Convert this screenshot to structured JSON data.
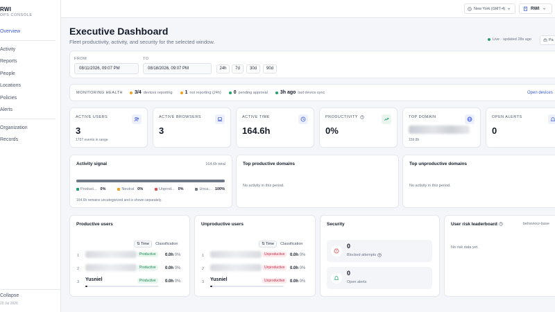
{
  "sidebar": {
    "brand": "RWI",
    "brand_sub": "OPS CONSOLE",
    "items": [
      {
        "label": "Overview"
      },
      {
        "label": "Activity"
      },
      {
        "label": "Reports"
      },
      {
        "label": "People"
      },
      {
        "label": "Locations"
      },
      {
        "label": "Policies"
      },
      {
        "label": "Alerts"
      },
      {
        "label": "Organization"
      },
      {
        "label": "Records"
      }
    ],
    "collapse_label": "Collapse",
    "footer_date": "20 Jul 2026"
  },
  "topbar": {
    "timezone": "New York (GMT-4)",
    "user": "RWI"
  },
  "header": {
    "title": "Executive Dashboard",
    "subtitle": "Fleet productivity, activity, and security for the selected window.",
    "live_status": "Live · updated 28s ago",
    "pa_button": "Pa"
  },
  "range": {
    "from_label": "FROM",
    "from_value": "08/11/2026, 09:07 PM",
    "to_label": "TO",
    "to_value": "08/18/2026, 09:07 PM",
    "quick": [
      "24h",
      "7d",
      "30d",
      "90d"
    ]
  },
  "health": {
    "title": "MONITORING HEALTH",
    "items": [
      {
        "value": "3/4",
        "label": "devices reporting",
        "color": "#f0a21b"
      },
      {
        "value": "1",
        "label": "not reporting (24h)",
        "color": "#f0a21b"
      },
      {
        "value": "0",
        "label": "pending approval",
        "color": "#22a06b"
      },
      {
        "value": "3h ago",
        "label": "last device sync",
        "color": "#22a06b"
      }
    ],
    "open_devices": "Open devices"
  },
  "stats": [
    {
      "label": "ACTIVE USERS",
      "value": "3",
      "hint": "1737 events in range",
      "icon": "users-icon"
    },
    {
      "label": "ACTIVE BROWSERS",
      "value": "3",
      "hint": "",
      "icon": "laptop-icon"
    },
    {
      "label": "ACTIVE TIME",
      "value": "164.6h",
      "hint": "",
      "icon": "clock-icon"
    },
    {
      "label": "PRODUCTIVITY",
      "value": "0%",
      "hint": "",
      "icon": "trend-up-icon"
    },
    {
      "label": "TOP DOMAIN",
      "value": "",
      "hint": "159.8h",
      "icon": "globe-icon"
    },
    {
      "label": "OPEN ALERTS",
      "value": "0",
      "hint": "",
      "icon": "bell-icon"
    }
  ],
  "activity_signal": {
    "title": "Activity signal",
    "total": "164.6h total",
    "legend": [
      {
        "label": "Product...",
        "value": "0%",
        "color": "#22a06b"
      },
      {
        "label": "Neutral",
        "value": "0%",
        "color": "#f0a21b"
      },
      {
        "label": "Unprod...",
        "value": "0%",
        "color": "#e5484d"
      },
      {
        "label": "Unca...",
        "value": "100%",
        "color": "#6e7788"
      }
    ],
    "note": "164.6h remains uncategorized and is shown separately."
  },
  "top_productive": {
    "title": "Top productive domains",
    "empty": "No activity in this period."
  },
  "top_unproductive": {
    "title": "Top unproductive domains",
    "empty": "No activity in this period."
  },
  "productive_users": {
    "title": "Productive users",
    "sort_label": "Time",
    "class_label": "Classification",
    "rows": [
      {
        "rank": "1",
        "name": "",
        "badge": "Productive",
        "time": "0.0h",
        "pct": "0%"
      },
      {
        "rank": "2",
        "name": "",
        "badge": "Productive",
        "time": "0.0h",
        "pct": "0%"
      },
      {
        "rank": "3",
        "name": "Yusniel",
        "badge": "Productive",
        "time": "0.0h",
        "pct": "0%"
      }
    ]
  },
  "unproductive_users": {
    "title": "Unproductive users",
    "sort_label": "Time",
    "class_label": "Classification",
    "rows": [
      {
        "rank": "1",
        "name": "",
        "badge": "Unproductive",
        "time": "0.0h",
        "pct": "0%"
      },
      {
        "rank": "2",
        "name": "",
        "badge": "Unproductive",
        "time": "0.0h",
        "pct": "0%"
      },
      {
        "rank": "3",
        "name": "Yusniel",
        "badge": "Unproductive",
        "time": "0.0h",
        "pct": "0%"
      }
    ]
  },
  "security": {
    "title": "Security",
    "blocked_value": "0",
    "blocked_label": "Blocked attempts",
    "alerts_value": "0",
    "alerts_label": "Open alerts"
  },
  "risk": {
    "title": "User risk leaderboard",
    "subtitle": "behaviour-base",
    "empty": "No risk data yet."
  }
}
